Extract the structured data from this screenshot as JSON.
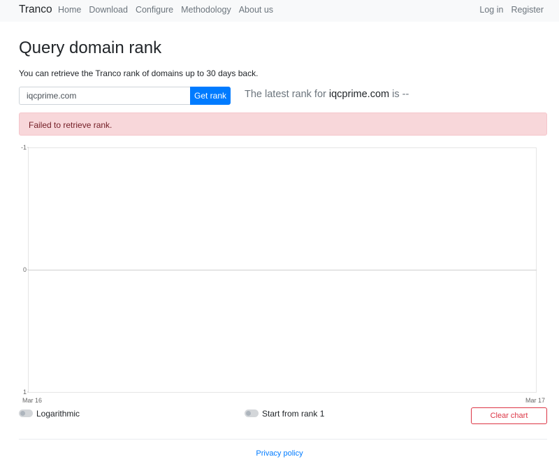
{
  "navbar": {
    "brand": "Tranco",
    "links": [
      "Home",
      "Download",
      "Configure",
      "Methodology",
      "About us"
    ],
    "right_links": [
      "Log in",
      "Register"
    ]
  },
  "page": {
    "title": "Query domain rank",
    "subtitle": "You can retrieve the Tranco rank of domains up to 30 days back."
  },
  "search": {
    "value": "iqcprime.com",
    "button_label": "Get rank"
  },
  "result": {
    "prefix": "The latest rank for ",
    "domain": "iqcprime.com",
    "middle": " is ",
    "rank": "--"
  },
  "alert": {
    "message": "Failed to retrieve rank."
  },
  "chart_data": {
    "type": "line",
    "series": [],
    "x_ticks": [
      "Mar 16",
      "Mar 17"
    ],
    "y_ticks": [
      -1,
      0,
      1
    ],
    "ylim": [
      -1,
      1
    ],
    "grid": false
  },
  "controls": {
    "logarithmic_label": "Logarithmic",
    "start_from_rank_label": "Start from rank 1",
    "clear_chart_label": "Clear chart"
  },
  "footer": {
    "privacy_label": "Privacy policy"
  },
  "colors": {
    "primary": "#007bff",
    "danger": "#dc3545",
    "alert_bg": "#f8d7da",
    "alert_text": "#721c24"
  }
}
